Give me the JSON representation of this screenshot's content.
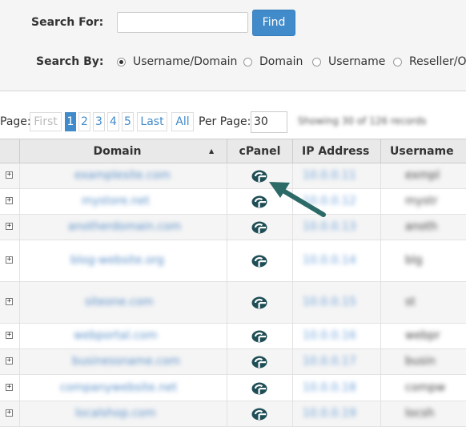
{
  "search": {
    "for_label": "Search For:",
    "input_value": "",
    "find_label": "Find",
    "by_label": "Search By:",
    "options": [
      {
        "label": "Username/Domain",
        "checked": true
      },
      {
        "label": "Domain",
        "checked": false
      },
      {
        "label": "Username",
        "checked": false
      },
      {
        "label": "Reseller/Ow",
        "checked": false
      }
    ]
  },
  "pager": {
    "label": "Page:",
    "first": "First",
    "pages": [
      "1",
      "2",
      "3",
      "4",
      "5"
    ],
    "current": "1",
    "last": "Last",
    "all": "All",
    "per_page_label": "Per Page:",
    "per_page_value": "30",
    "showing_text": "Showing 30 of 126 records"
  },
  "table": {
    "headers": {
      "domain": "Domain",
      "cpanel": "cPanel",
      "ip": "IP Address",
      "username": "Username"
    },
    "sort_icon": "sort-ascending-icon",
    "rows": [
      {
        "domain": "examplesite.com",
        "ip": "10.0.0.11",
        "user": "exmpl"
      },
      {
        "domain": "mystore.net",
        "ip": "10.0.0.12",
        "user": "mystr"
      },
      {
        "domain": "anotherdomain.com",
        "ip": "10.0.0.13",
        "user": "anoth"
      },
      {
        "domain": "blog-website.org",
        "ip": "10.0.0.14",
        "user": "blg"
      },
      {
        "domain": "siteone.com",
        "ip": "10.0.0.15",
        "user": "st"
      },
      {
        "domain": "webportal.com",
        "ip": "10.0.0.16",
        "user": "webpr"
      },
      {
        "domain": "businessname.com",
        "ip": "10.0.0.17",
        "user": "busin"
      },
      {
        "domain": "companywebsite.net",
        "ip": "10.0.0.18",
        "user": "compw"
      },
      {
        "domain": "localshop.com",
        "ip": "10.0.0.19",
        "user": "locsh"
      }
    ]
  },
  "colors": {
    "accent": "#428bca",
    "arrow": "#2b6a67",
    "cpanel_icon": "#1f4e56"
  },
  "icons": {
    "expand": "expand-plus-icon",
    "cpanel": "cpanel-logo-icon",
    "annotation": "annotation-arrow-icon"
  }
}
